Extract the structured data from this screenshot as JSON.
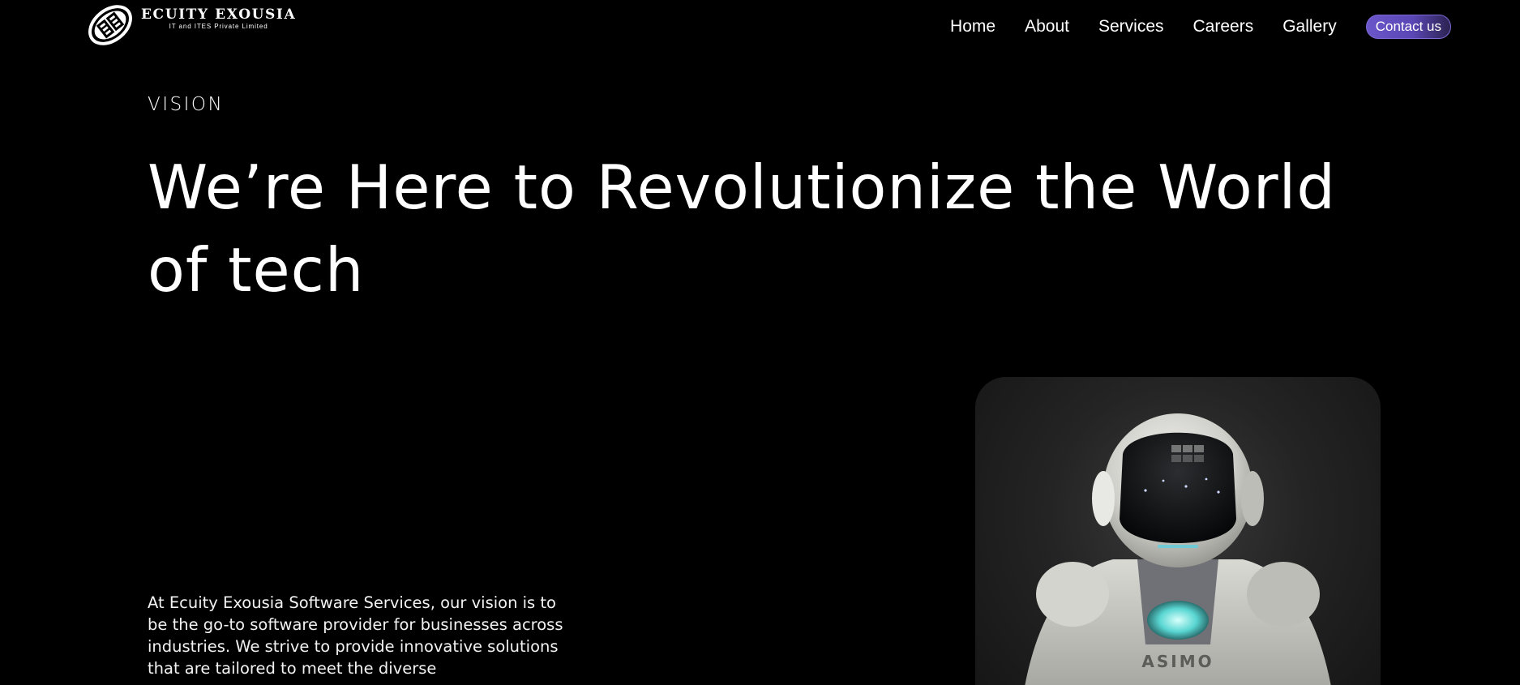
{
  "brand": {
    "name": "ECUITY EXOUSIA",
    "tagline": "IT and ITES Private Limited",
    "logo_icon": "ee-monogram-icon"
  },
  "nav": {
    "items": [
      {
        "label": "Home"
      },
      {
        "label": "About"
      },
      {
        "label": "Services"
      },
      {
        "label": "Careers"
      },
      {
        "label": "Gallery"
      }
    ],
    "cta_label": "Contact us"
  },
  "hero": {
    "eyebrow": "VISION",
    "headline": "We’re Here to Revolutionize the World of tech",
    "body": "At Ecuity Exousia Software Services, our vision is to be the go-to software provider for businesses across industries. We strive to provide innovative solutions that are tailored to meet the diverse",
    "image_label": "ASIMO"
  },
  "colors": {
    "background": "#000000",
    "text": "#ffffff",
    "cta_gradient_start": "#6a56c9",
    "cta_gradient_end": "#2b2250"
  }
}
